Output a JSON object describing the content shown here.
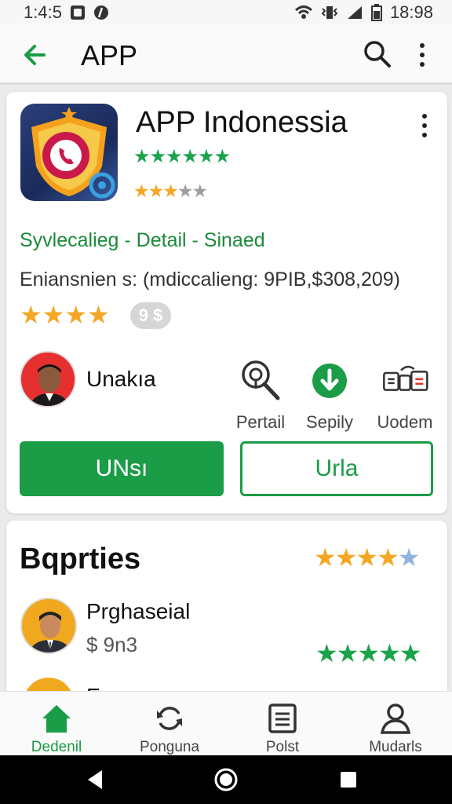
{
  "status_bar": {
    "time_left": "1:4:5",
    "time_right": "18:98"
  },
  "app_bar": {
    "title": "APP"
  },
  "app_card": {
    "name": "APP Indonessia",
    "green_stars": "★★★★★★",
    "mixed_stars_filled": "★★★",
    "mixed_stars_empty": "★★",
    "categories": "Syvlecalieg - Detail - Sinaed",
    "description": "Eniansnien s: (mdiccalieng: 9PIB,$308,209)",
    "rating_stars": "★★★★",
    "badge": "9 $",
    "user_name": "Unakıa",
    "actions": [
      {
        "label": "Pertail",
        "icon": "magnifier-pin-icon"
      },
      {
        "label": "Sepily",
        "icon": "download-icon"
      },
      {
        "label": "Uodem",
        "icon": "devices-icon"
      }
    ],
    "primary_button": "UNsı",
    "outline_button": "Urla"
  },
  "section": {
    "title": "Bqprties",
    "stars_filled": "★★★★",
    "stars_last": "★",
    "item": {
      "name": "Prghaseial",
      "price": "$ 9n3",
      "stars": "★★★★★"
    },
    "peek": "F"
  },
  "bottom_nav": [
    {
      "label": "Dedenil",
      "icon": "home-icon",
      "active": true
    },
    {
      "label": "Ponguna",
      "icon": "sync-icon",
      "active": false
    },
    {
      "label": "Polst",
      "icon": "document-icon",
      "active": false
    },
    {
      "label": "Mudarls",
      "icon": "person-icon",
      "active": false
    }
  ],
  "colors": {
    "accent": "#1b9c47",
    "star": "#f5a623"
  }
}
